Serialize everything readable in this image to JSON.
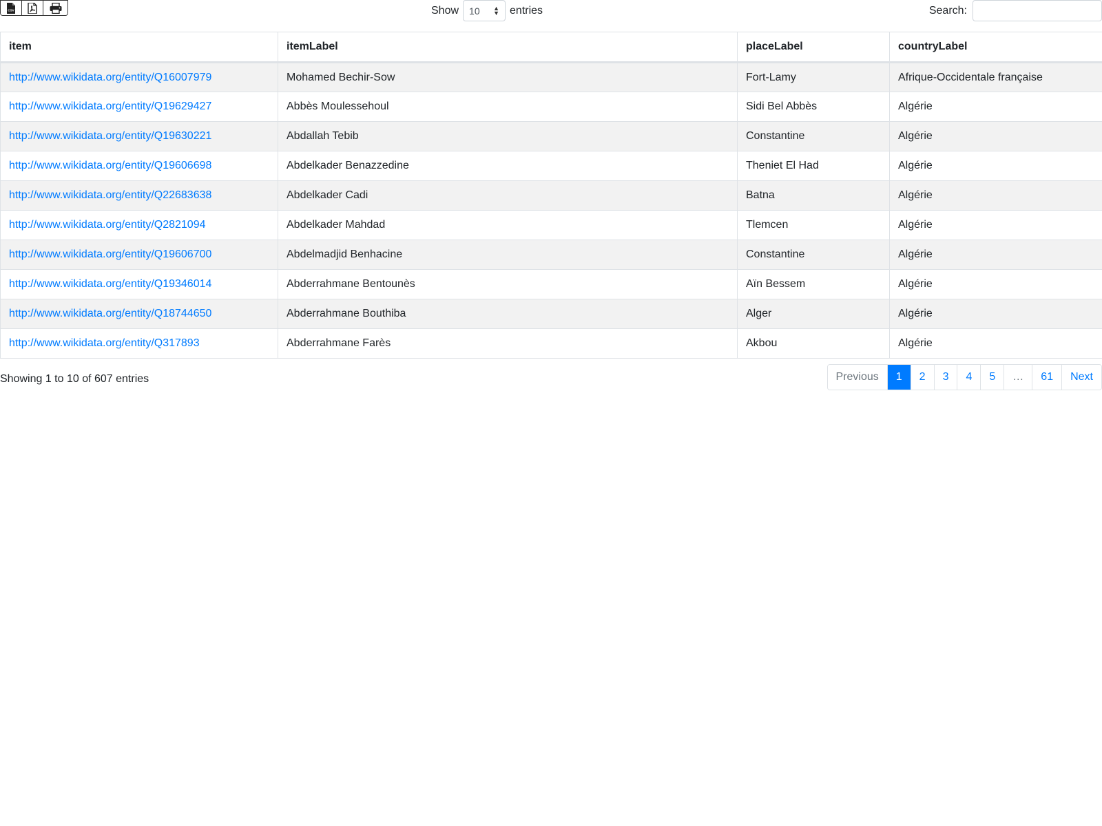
{
  "export": {
    "buttons": [
      {
        "icon": "csv-file-icon",
        "label": "CSV"
      },
      {
        "icon": "pdf-file-icon"
      },
      {
        "icon": "print-icon"
      }
    ]
  },
  "length": {
    "show_label": "Show",
    "value": "10",
    "entries_label": "entries"
  },
  "search": {
    "label": "Search:",
    "value": "",
    "placeholder": ""
  },
  "table": {
    "columns": [
      "item",
      "itemLabel",
      "placeLabel",
      "countryLabel"
    ],
    "rows": [
      [
        "http://www.wikidata.org/entity/Q16007979",
        "Mohamed Bechir-Sow",
        "Fort-Lamy",
        "Afrique-Occidentale française"
      ],
      [
        "http://www.wikidata.org/entity/Q19629427",
        "Abbès Moulessehoul",
        "Sidi Bel Abbès",
        "Algérie"
      ],
      [
        "http://www.wikidata.org/entity/Q19630221",
        "Abdallah Tebib",
        "Constantine",
        "Algérie"
      ],
      [
        "http://www.wikidata.org/entity/Q19606698",
        "Abdelkader Benazzedine",
        "Theniet El Had",
        "Algérie"
      ],
      [
        "http://www.wikidata.org/entity/Q22683638",
        "Abdelkader Cadi",
        "Batna",
        "Algérie"
      ],
      [
        "http://www.wikidata.org/entity/Q2821094",
        "Abdelkader Mahdad",
        "Tlemcen",
        "Algérie"
      ],
      [
        "http://www.wikidata.org/entity/Q19606700",
        "Abdelmadjid Benhacine",
        "Constantine",
        "Algérie"
      ],
      [
        "http://www.wikidata.org/entity/Q19346014",
        "Abderrahmane Bentounès",
        "Aïn Bessem",
        "Algérie"
      ],
      [
        "http://www.wikidata.org/entity/Q18744650",
        "Abderrahmane Bouthiba",
        "Alger",
        "Algérie"
      ],
      [
        "http://www.wikidata.org/entity/Q317893",
        "Abderrahmane Farès",
        "Akbou",
        "Algérie"
      ]
    ]
  },
  "footer": {
    "info": "Showing 1 to 10 of 607 entries",
    "pagination": {
      "previous": "Previous",
      "pages": [
        "1",
        "2",
        "3",
        "4",
        "5",
        "…",
        "61"
      ],
      "active_page": "1",
      "next": "Next"
    }
  },
  "colors": {
    "link": "#007bff",
    "active_page_bg": "#007bff",
    "stripe": "#f2f2f2",
    "border": "#dee2e6"
  }
}
